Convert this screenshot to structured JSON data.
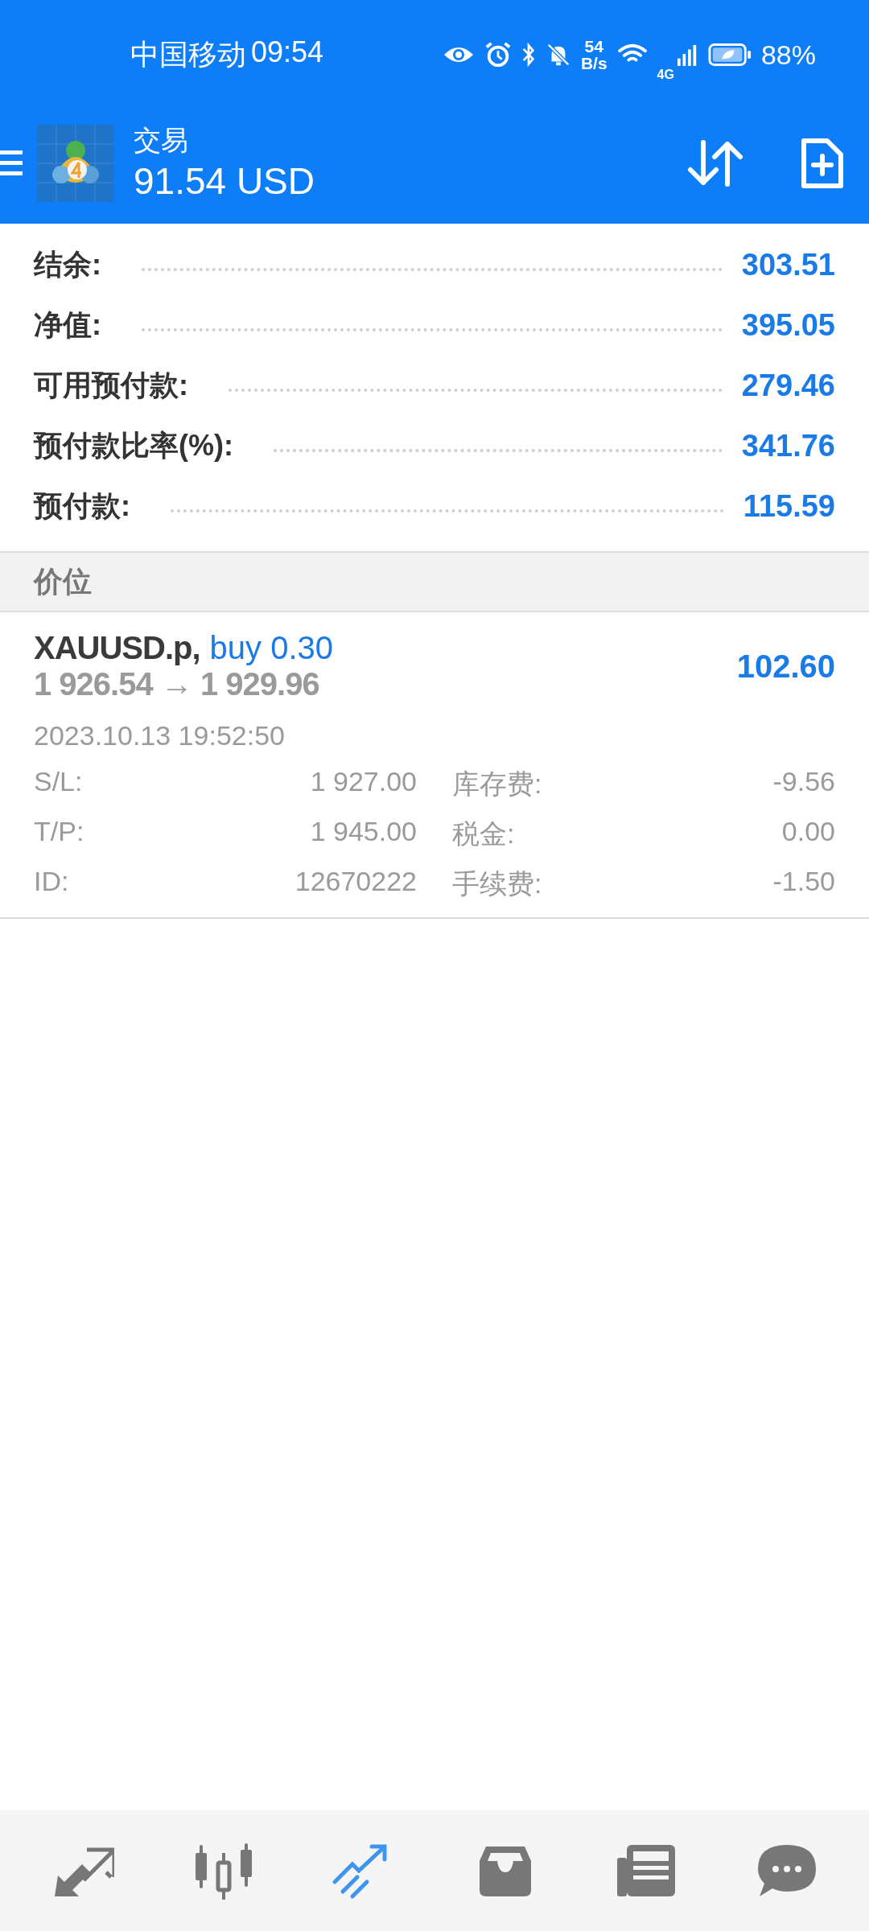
{
  "status_bar": {
    "carrier": "中国移动",
    "time": "09:54",
    "speed_value": "54",
    "speed_unit": "B/s",
    "network": "4G",
    "battery": "88%"
  },
  "header": {
    "title": "交易",
    "balance": "91.54 USD"
  },
  "summary": [
    {
      "label": "结余:",
      "value": "303.51"
    },
    {
      "label": "净值:",
      "value": "395.05"
    },
    {
      "label": "可用预付款:",
      "value": "279.46"
    },
    {
      "label": "预付款比率(%):",
      "value": "341.76"
    },
    {
      "label": "预付款:",
      "value": "115.59"
    }
  ],
  "section_title": "价位",
  "positions": [
    {
      "symbol": "XAUUSD.p,",
      "order": "buy 0.30",
      "prices": "1 926.54 → 1 929.96",
      "profit": "102.60",
      "time": "2023.10.13 19:52:50",
      "details": [
        {
          "label": "S/L:",
          "value": "1 927.00"
        },
        {
          "label": "库存费:",
          "value": "-9.56"
        },
        {
          "label": "T/P:",
          "value": "1 945.00"
        },
        {
          "label": "税金:",
          "value": "0.00"
        },
        {
          "label": "ID:",
          "value": "12670222"
        },
        {
          "label": "手续费:",
          "value": "-1.50"
        }
      ]
    }
  ],
  "bottom_nav": [
    {
      "kind": "quotes",
      "selected": false
    },
    {
      "kind": "chart",
      "selected": false
    },
    {
      "kind": "trade",
      "selected": true
    },
    {
      "kind": "history",
      "selected": false
    },
    {
      "kind": "news",
      "selected": false
    },
    {
      "kind": "chat",
      "selected": false
    }
  ]
}
